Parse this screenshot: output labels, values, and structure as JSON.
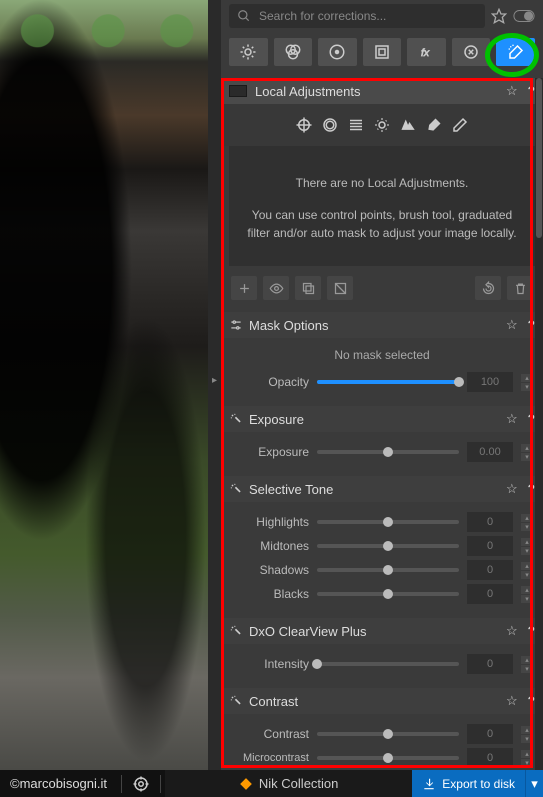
{
  "search": {
    "placeholder": "Search for corrections..."
  },
  "sections": {
    "local_adjustments": {
      "title": "Local Adjustments",
      "empty1": "There are no Local Adjustments.",
      "empty2": "You can use control points, brush tool, graduated filter and/or auto mask to adjust your image locally."
    },
    "mask_options": {
      "title": "Mask Options",
      "no_mask": "No mask selected",
      "opacity_label": "Opacity",
      "opacity_value": "100"
    },
    "exposure": {
      "title": "Exposure",
      "exposure_label": "Exposure",
      "exposure_value": "0.00"
    },
    "selective_tone": {
      "title": "Selective Tone",
      "highlights_label": "Highlights",
      "highlights_value": "0",
      "midtones_label": "Midtones",
      "midtones_value": "0",
      "shadows_label": "Shadows",
      "shadows_value": "0",
      "blacks_label": "Blacks",
      "blacks_value": "0"
    },
    "clearview": {
      "title": "DxO ClearView Plus",
      "intensity_label": "Intensity",
      "intensity_value": "0"
    },
    "contrast": {
      "title": "Contrast",
      "contrast_label": "Contrast",
      "contrast_value": "0",
      "micro_label": "Microcontrast",
      "micro_value": "0"
    }
  },
  "footer": {
    "credit": "©marcobisogni.it",
    "nik": "Nik Collection",
    "export": "Export to disk"
  },
  "colors": {
    "accent": "#1e90ff",
    "annotation_red": "#ff0000",
    "annotation_green": "#00c000",
    "export_blue": "#0a6cc0"
  }
}
